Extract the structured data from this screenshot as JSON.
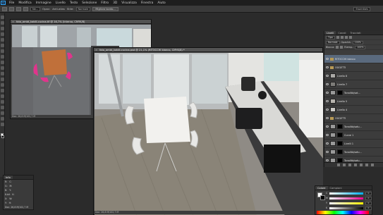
{
  "app": {
    "logo": "Ps"
  },
  "menu": [
    "File",
    "Modifica",
    "Immagine",
    "Livello",
    "Testo",
    "Selezione",
    "Filtro",
    "3D",
    "Visualizza",
    "Finestra",
    "Aiuto"
  ],
  "options": {
    "mode_value": "Ne...",
    "opacity_label": "Opac:",
    "aa_label": "Anti-alias",
    "style_label": "Stile:",
    "style_value": "Normale",
    "refine_label": "Migliora bordo...",
    "workspace": "Essentials"
  },
  "documents": [
    {
      "tab": "foto_ambt_kabili-cucina.tif @ 16,7% (Interno, CMYK/8)",
      "status": "Doc: 26,8 M/102,7 M"
    },
    {
      "tab": "foto_ambt_kabili-cucina.psd @ 21,1% (RITOCCHI bianco, CMYK/8) *",
      "status": "Doc: 26,8 M/102,7 M"
    }
  ],
  "layers_panel": {
    "tabs": [
      "Livelli",
      "Canali",
      "Tracciati"
    ],
    "filter_label": "Tipo",
    "blend_mode": "Normale",
    "opacity_label": "Opacità:",
    "opacity_value": "100%",
    "lock_label": "Blocca:",
    "fill_label": "Riemp.:",
    "fill_value": "100%",
    "layers": [
      {
        "name": "RITOCCHI bianco",
        "type": "folder",
        "selected": true,
        "thumb": "#c9c6c0"
      },
      {
        "name": "OGGETTI",
        "type": "folder",
        "selected": false,
        "thumb": "#8a8a8a"
      },
      {
        "name": "Livello 8",
        "type": "layer",
        "selected": false,
        "thumb": "#aaa9a6"
      },
      {
        "name": "Livello 7",
        "type": "layer",
        "selected": false,
        "thumb": "#7d7c79"
      },
      {
        "name": "Tonalità/sat...",
        "type": "adjustment",
        "selected": false,
        "thumb": "#9a9a9a"
      },
      {
        "name": "Livello 5",
        "type": "layer",
        "selected": false,
        "thumb": "#b7b4ae"
      },
      {
        "name": "Livello 4",
        "type": "layer",
        "selected": false,
        "thumb": "#cbc9c5"
      },
      {
        "name": "OGGETTI",
        "type": "folder",
        "selected": false,
        "thumb": "#8a8a8a"
      },
      {
        "name": "Tonalità/satu...",
        "type": "adjustment",
        "selected": false,
        "thumb": "#9a9a9a"
      },
      {
        "name": "Curve 1",
        "type": "adjustment",
        "selected": false,
        "thumb": "#9a9a9a"
      },
      {
        "name": "Livelli 1",
        "type": "adjustment",
        "selected": false,
        "thumb": "#9a9a9a"
      },
      {
        "name": "Tonalità/satu...",
        "type": "adjustment",
        "selected": false,
        "thumb": "#9a9a9a"
      },
      {
        "name": "Tonalità/satu...",
        "type": "adjustment",
        "selected": false,
        "thumb": "#9a9a9a"
      },
      {
        "name": "Sfondo copia",
        "type": "layer",
        "selected": false,
        "thumb": "#8f8d88"
      },
      {
        "name": "Sfondo",
        "type": "layer",
        "selected": false,
        "thumb": "#8f8d88"
      }
    ]
  },
  "info_panel": {
    "title": "Info",
    "rows": [
      [
        "R:",
        "C:"
      ],
      [
        "G:",
        "M:"
      ],
      [
        "B:",
        "Y:"
      ],
      [
        "8-bit",
        "K:"
      ],
      [
        "X:",
        "W:"
      ],
      [
        "Y:",
        "H:"
      ]
    ],
    "status": "Doc: 26,8 M/102,7 M"
  },
  "color_panel": {
    "tabs": [
      "Colore",
      "Campioni"
    ],
    "labels": [
      "C",
      "M",
      "Y",
      "K"
    ],
    "values": [
      "0",
      "0",
      "0",
      "0"
    ],
    "foreground": "#ffffff",
    "background": "#000000"
  },
  "colors": {
    "accent": "#31a8ff",
    "selected_layer": "#5a6a7e",
    "chair_pink": "#e0358c"
  }
}
